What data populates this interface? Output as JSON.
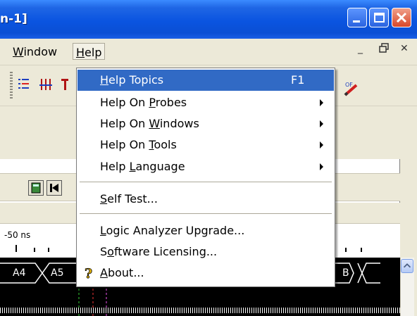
{
  "window": {
    "title_fragment": "n-1]"
  },
  "menubar": {
    "items": [
      {
        "id": "window",
        "pre": "",
        "ul": "W",
        "post": "indow"
      },
      {
        "id": "help",
        "pre": "",
        "ul": "H",
        "post": "elp"
      }
    ]
  },
  "time_ruler": {
    "label": "-50 ns"
  },
  "bus": {
    "labels": [
      "A4",
      "A5",
      "B"
    ]
  },
  "help_menu": {
    "items": [
      {
        "pre": "",
        "ul": "H",
        "post": "elp Topics",
        "accel": "F1",
        "submenu": false,
        "selected": true
      },
      {
        "pre": "Help On ",
        "ul": "P",
        "post": "robes",
        "accel": "",
        "submenu": true,
        "selected": false
      },
      {
        "pre": "Help On ",
        "ul": "W",
        "post": "indows",
        "accel": "",
        "submenu": true,
        "selected": false
      },
      {
        "pre": "Help On ",
        "ul": "T",
        "post": "ools",
        "accel": "",
        "submenu": true,
        "selected": false
      },
      {
        "pre": "Help ",
        "ul": "L",
        "post": "anguage",
        "accel": "",
        "submenu": true,
        "selected": false
      },
      {
        "pre": "",
        "ul": "S",
        "post": "elf Test...",
        "accel": "",
        "submenu": false,
        "selected": false
      },
      {
        "pre": "",
        "ul": "L",
        "post": "ogic Analyzer Upgrade...",
        "accel": "",
        "submenu": false,
        "selected": false
      },
      {
        "pre": "S",
        "ul": "o",
        "post": "ftware Licensing...",
        "accel": "",
        "submenu": false,
        "selected": false
      },
      {
        "pre": "",
        "ul": "A",
        "post": "bout...",
        "accel": "",
        "submenu": false,
        "selected": false,
        "icon": "question-mark-icon"
      }
    ]
  },
  "colors": {
    "selection": "#316ac5",
    "titlebar": "#0a54e0"
  }
}
